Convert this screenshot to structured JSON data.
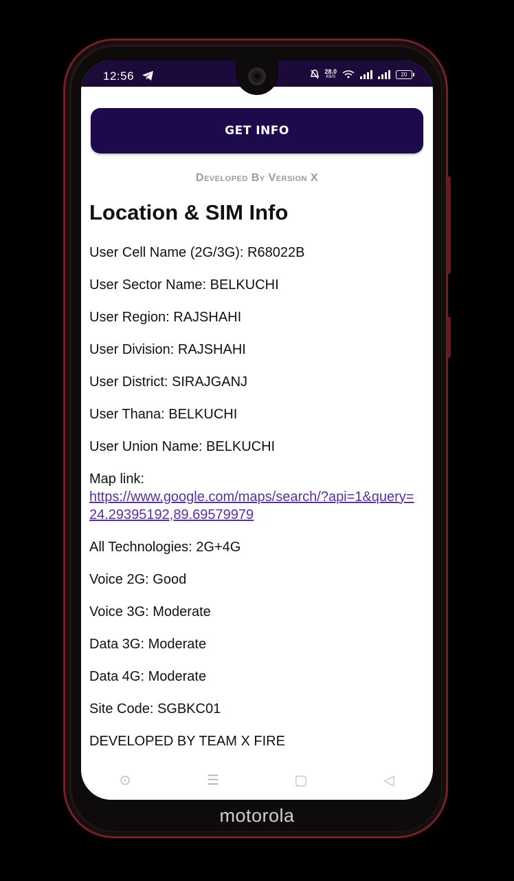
{
  "status_bar": {
    "time": "12:56",
    "speed_value": "28.0",
    "speed_unit": "KB/S",
    "battery": "20"
  },
  "get_info_button": "GET INFO",
  "developed_by": "Developed By Version X",
  "heading": "Location & SIM Info",
  "rows": [
    "User Cell Name (2G/3G): R68022B",
    "User Sector Name: BELKUCHI",
    "User Region: RAJSHAHI",
    "User Division: RAJSHAHI",
    "User District: SIRAJGANJ",
    "User Thana: BELKUCHI",
    "User Union Name: BELKUCHI"
  ],
  "map": {
    "label": "Map link:",
    "url": "https://www.google.com/maps/search/?api=1&query=24.29395192,89.69579979"
  },
  "rows2": [
    "All Technologies: 2G+4G",
    "Voice 2G: Good",
    "Voice 3G: Moderate",
    "Data 3G: Moderate",
    "Data 4G: Moderate",
    "Site Code: SGBKC01",
    "DEVELOPED BY TEAM X FIRE"
  ],
  "nav": {
    "home_icon": "⊙",
    "menu_icon": "☰",
    "recents_icon": "▢",
    "back_icon": "◁"
  },
  "brand": "motorola",
  "colors": {
    "accent": "#1c0a4a",
    "link": "#5a2fa0",
    "status_bar": "#1c0a3a"
  }
}
